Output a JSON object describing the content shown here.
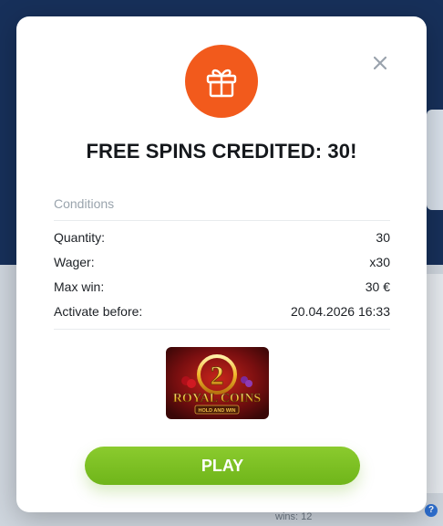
{
  "modal": {
    "title": "FREE SPINS CREDITED: 30!",
    "conditions_label": "Conditions",
    "conditions": [
      {
        "label": "Quantity:",
        "value": "30"
      },
      {
        "label": "Wager:",
        "value": "x30"
      },
      {
        "label": "Max win:",
        "value": "30 €"
      },
      {
        "label": "Activate before:",
        "value": "20.04.2026 16:33"
      }
    ],
    "game": {
      "title_number": "2",
      "title_main": "ROYAL COINS",
      "subtitle": "HOLD AND WIN"
    },
    "play_label": "PLAY",
    "icons": {
      "gift": "gift-icon",
      "close": "close-icon"
    }
  },
  "background": {
    "bottom_text": "wins: 12",
    "help": "?"
  },
  "colors": {
    "accent_orange": "#f25a1c",
    "play_green": "#7cc024",
    "title_text": "#15181c",
    "muted_text": "#9aa4ad"
  }
}
